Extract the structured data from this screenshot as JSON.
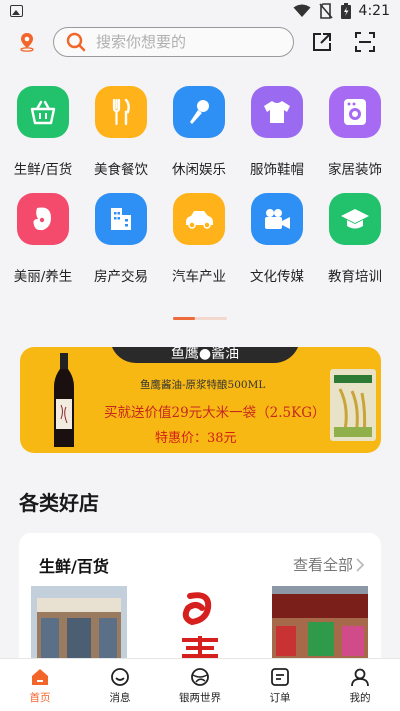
{
  "status_bar": {
    "time": "4:21"
  },
  "search": {
    "placeholder": "搜索你想要的"
  },
  "categories": [
    {
      "label": "生鲜/百货",
      "color": "#22c16b"
    },
    {
      "label": "美食餐饮",
      "color": "#ffb21a"
    },
    {
      "label": "休闲娱乐",
      "color": "#2e8ff5"
    },
    {
      "label": "服饰鞋帽",
      "color": "#9a6af0"
    },
    {
      "label": "家居装饰",
      "color": "#a76bf3"
    },
    {
      "label": "美丽/养生",
      "color": "#f44a6c"
    },
    {
      "label": "房产交易",
      "color": "#2e8ff5"
    },
    {
      "label": "汽车产业",
      "color": "#ffb21a"
    },
    {
      "label": "文化传媒",
      "color": "#2e8ff5"
    },
    {
      "label": "教育培训",
      "color": "#22c16b"
    }
  ],
  "banner": {
    "brand": "鱼鹰●酱油",
    "line1": "鱼鹰酱油-原浆特酿500ML",
    "line2": "买就送价值29元大米一袋（2.5KG）",
    "line3": "特惠价：38元"
  },
  "section": {
    "title": "各类好店"
  },
  "store_card": {
    "title": "生鲜/百货",
    "more": "查看全部"
  },
  "tabs": [
    {
      "label": "首页",
      "active": true
    },
    {
      "label": "消息",
      "active": false
    },
    {
      "label": "银两世界",
      "active": false
    },
    {
      "label": "订单",
      "active": false
    },
    {
      "label": "我的",
      "active": false
    }
  ],
  "colors": {
    "accent": "#f2652b",
    "background": "#f4f4f6",
    "banner": "#f7b814"
  }
}
